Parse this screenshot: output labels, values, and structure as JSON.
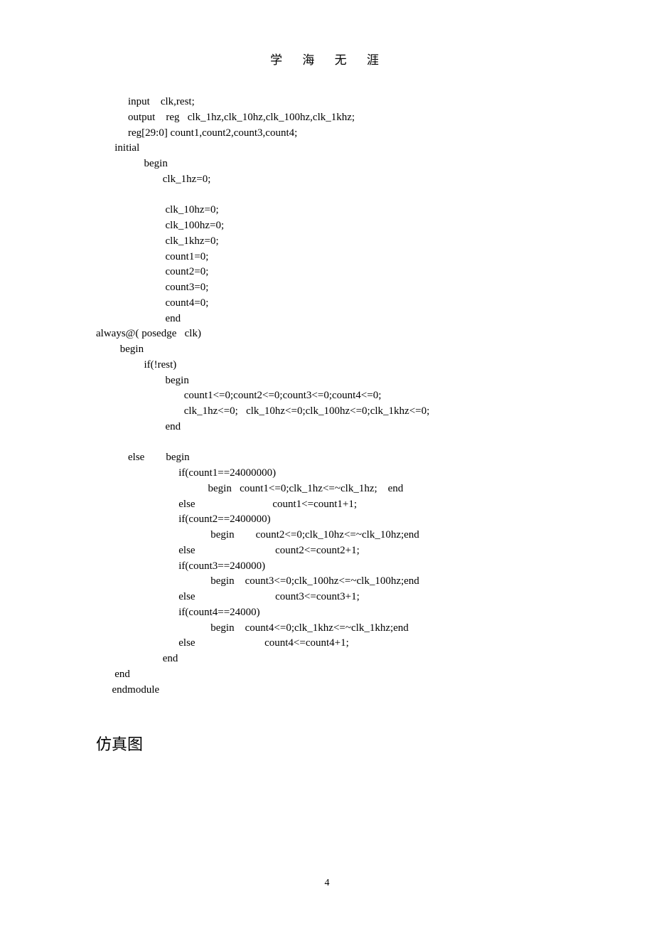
{
  "header": "学 海 无 涯",
  "code_lines": [
    "            input    clk,rest;",
    "            output    reg   clk_1hz,clk_10hz,clk_100hz,clk_1khz;",
    "            reg[29:0] count1,count2,count3,count4;",
    "       initial",
    "                  begin",
    "                         clk_1hz=0;",
    "",
    "                          clk_10hz=0;",
    "                          clk_100hz=0;",
    "                          clk_1khz=0;",
    "                          count1=0;",
    "                          count2=0;",
    "                          count3=0;",
    "                          count4=0;",
    "                          end",
    "always@( posedge   clk)",
    "         begin",
    "                  if(!rest)",
    "                          begin",
    "                                 count1<=0;count2<=0;count3<=0;count4<=0;",
    "                                 clk_1hz<=0;   clk_10hz<=0;clk_100hz<=0;clk_1khz<=0;",
    "                          end",
    "",
    "            else        begin",
    "                               if(count1==24000000)",
    "                                          begin   count1<=0;clk_1hz<=~clk_1hz;    end",
    "                               else                             count1<=count1+1;",
    "                               if(count2==2400000)",
    "                                           begin        count2<=0;clk_10hz<=~clk_10hz;end",
    "                               else                              count2<=count2+1;",
    "                               if(count3==240000)",
    "                                           begin    count3<=0;clk_100hz<=~clk_100hz;end",
    "                               else                              count3<=count3+1;",
    "                               if(count4==24000)",
    "                                           begin    count4<=0;clk_1khz<=~clk_1khz;end",
    "                               else                          count4<=count4+1;",
    "                         end",
    "       end",
    "      endmodule"
  ],
  "section_heading": "仿真图",
  "page_number": "4"
}
